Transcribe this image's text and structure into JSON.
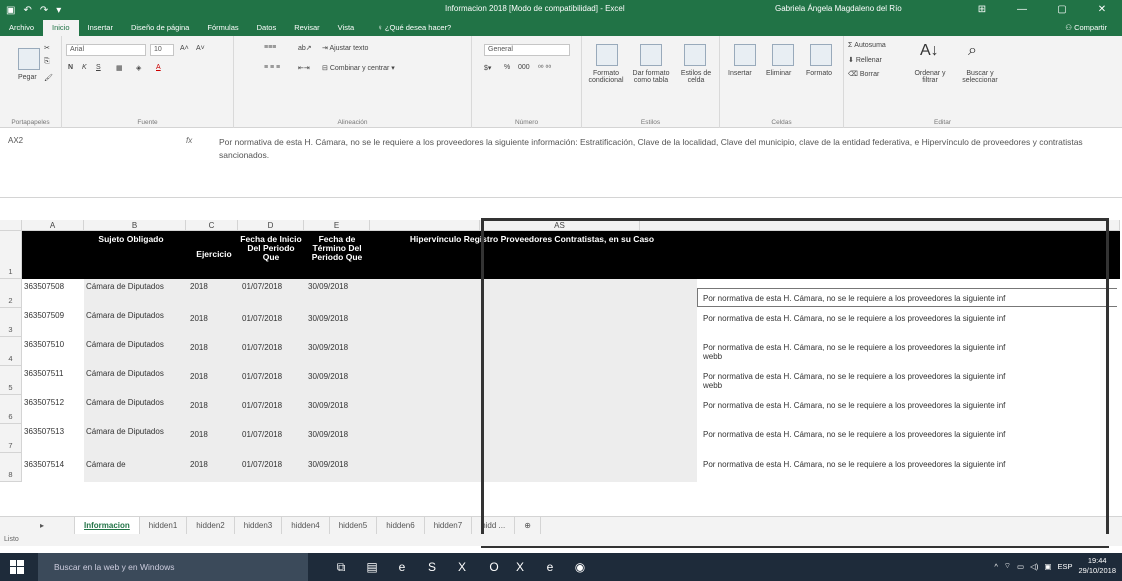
{
  "window": {
    "title": "Informacion 2018 [Modo de compatibilidad] - Excel",
    "user": "Gabriela Ángela Magdaleno del Río",
    "controls": [
      "⊞",
      "—",
      "▢",
      "✕"
    ]
  },
  "ribbon_tabs": [
    "Archivo",
    "Inicio",
    "Insertar",
    "Diseño de página",
    "Fórmulas",
    "Datos",
    "Revisar",
    "Vista"
  ],
  "tellme": "¿Qué desea hacer?",
  "share": "Compartir",
  "ribbon": {
    "paste": "Pegar",
    "font_name": "Arial",
    "font_size": "10",
    "bold": "N",
    "italic": "K",
    "underline": "S",
    "wrap_text": "Ajustar texto",
    "merge_center": "Combinar y centrar",
    "number_format": "General",
    "percent": "%",
    "thousands": "000",
    "cond_format": "Formato condicional",
    "table_format": "Dar formato como tabla",
    "cell_styles": "Estilos de celda",
    "insert": "Insertar",
    "delete": "Eliminar",
    "format": "Formato",
    "autosum": "Autosuma",
    "fill": "Rellenar",
    "clear": "Borrar",
    "sort_filter": "Ordenar y filtrar",
    "find_select": "Buscar y seleccionar",
    "group_labels": {
      "clipboard": "Portapapeles",
      "font": "Fuente",
      "alignment": "Alineación",
      "number": "Número",
      "styles": "Estilos",
      "cells": "Celdas",
      "editing": "Editar"
    }
  },
  "formula_bar": {
    "name_box": "AX2",
    "fx": "fx",
    "content": "Por normativa de esta H. Cámara, no se le requiere a los proveedores la siguiente información: Estratificación, Clave de la localidad, Clave del municipio, clave de la entidad federativa,  e Hipervínculo de proveedores y contratistas sancionados."
  },
  "sheet": {
    "columns": [
      "A",
      "B",
      "C",
      "D",
      "E",
      "AS"
    ],
    "headers": {
      "b": "Sujeto Obligado",
      "c": "Ejercicio",
      "d": "Fecha de Inicio Del Periodo Que",
      "e": "Fecha de Término Del Periodo Que",
      "hipervinculo": "Hipervínculo Registro Proveedores Contratistas, en su Caso"
    },
    "rows": [
      {
        "num": "2",
        "a": "363507508",
        "b": "Cámara de Diputados",
        "c": "2018",
        "d": "01/07/2018",
        "e": "30/09/2018",
        "note": "Por normativa de esta H. Cámara, no se le requiere a los proveedores la siguiente inf",
        "note2": ""
      },
      {
        "num": "3",
        "a": "363507509",
        "b": "Cámara de Diputados",
        "c": "2018",
        "d": "01/07/2018",
        "e": "30/09/2018",
        "note": "Por normativa de esta H. Cámara, no se le requiere a los proveedores la siguiente inf",
        "note2": ""
      },
      {
        "num": "4",
        "a": "363507510",
        "b": "Cámara de Diputados",
        "c": "2018",
        "d": "01/07/2018",
        "e": "30/09/2018",
        "note": "Por normativa de esta H. Cámara, no se le requiere a los proveedores la siguiente inf",
        "note2": "webb"
      },
      {
        "num": "5",
        "a": "363507511",
        "b": "Cámara de Diputados",
        "c": "2018",
        "d": "01/07/2018",
        "e": "30/09/2018",
        "note": "Por normativa de esta H. Cámara, no se le requiere a los proveedores la siguiente inf",
        "note2": "webb"
      },
      {
        "num": "6",
        "a": "363507512",
        "b": "Cámara de Diputados",
        "c": "2018",
        "d": "01/07/2018",
        "e": "30/09/2018",
        "note": "Por normativa de esta H. Cámara, no se le requiere a los proveedores la siguiente inf",
        "note2": ""
      },
      {
        "num": "7",
        "a": "363507513",
        "b": "Cámara de Diputados",
        "c": "2018",
        "d": "01/07/2018",
        "e": "30/09/2018",
        "note": "Por normativa de esta H. Cámara, no se le requiere a los proveedores la siguiente inf",
        "note2": ""
      },
      {
        "num": "8",
        "a": "363507514",
        "b": "Cámara de",
        "c": "2018",
        "d": "01/07/2018",
        "e": "30/09/2018",
        "note": "Por normativa de esta H. Cámara, no se le requiere a los proveedores la siguiente inf",
        "note2": ""
      }
    ],
    "header_row_num": "1"
  },
  "sheet_tabs": [
    "Informacion",
    "hidden1",
    "hidden2",
    "hidden3",
    "hidden4",
    "hidden5",
    "hidden6",
    "hidden7",
    "hidd ..."
  ],
  "add_sheet": "⊕",
  "status": "Listo",
  "taskbar": {
    "search": "Buscar en la web y en Windows",
    "lang": "ESP",
    "time": "19:44",
    "date": "29/10/2018"
  }
}
